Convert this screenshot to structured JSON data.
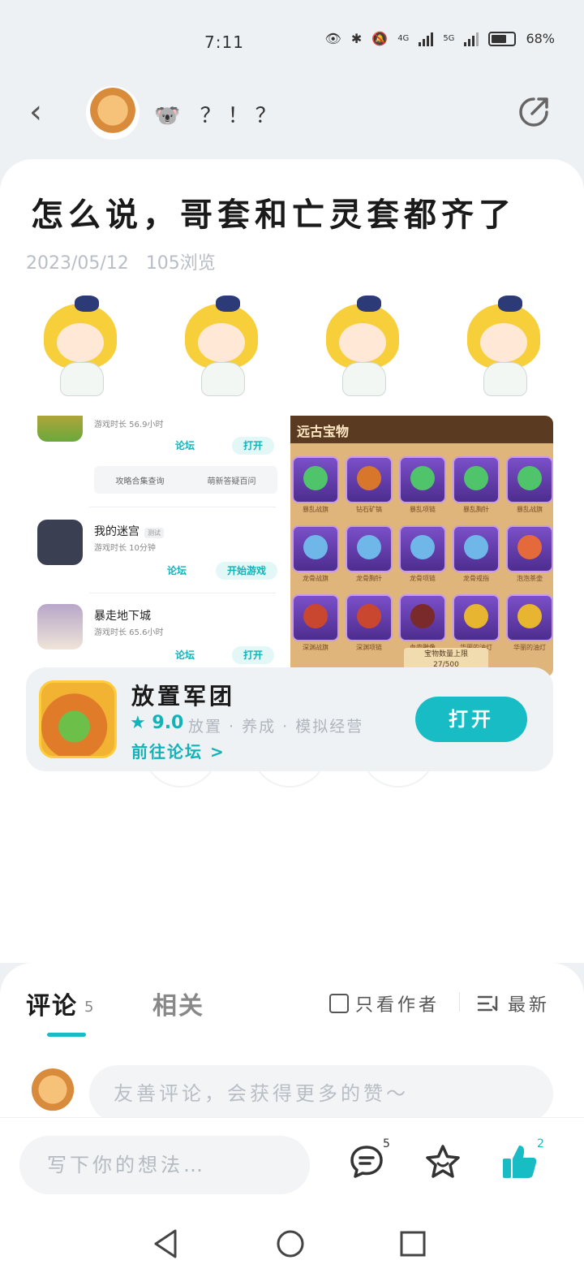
{
  "status_bar": {
    "time": "7:11",
    "network_4g": "4G",
    "network_5g": "5G",
    "battery": "68%"
  },
  "nav": {
    "author_name": "🐨 ？！？"
  },
  "post": {
    "title": "怎么说，哥套和亡灵套都齐了",
    "date": "2023/05/12",
    "views": "105浏览"
  },
  "screenshot": {
    "left": {
      "row1": {
        "play_time": "游戏时长 56.9小时",
        "forum": "论坛",
        "action": "打开"
      },
      "faq": [
        "攻略合集查询",
        "萌新答疑百问"
      ],
      "row2": {
        "name": "我的迷宫",
        "tag": "测试",
        "play_time": "游戏时长 10分钟",
        "forum": "论坛",
        "action": "开始游戏"
      },
      "row3": {
        "name": "暴走地下城",
        "play_time": "游戏时长 65.6小时",
        "forum": "论坛",
        "action": "打开"
      }
    },
    "right": {
      "header": "远古宝物",
      "items": [
        "暴乱战旗",
        "钻石矿镐",
        "暴乱项链",
        "暴乱胸针",
        "暴乱战旗",
        "龙骨战旗",
        "龙骨胸针",
        "龙骨项链",
        "龙骨戒指",
        "泡泡茶壶",
        "深渊战旗",
        "深渊项链",
        "血肉雕像",
        "华丽的油灯",
        "华丽的油灯"
      ],
      "footer_label": "宝物数量上限",
      "footer_count": "27/500"
    }
  },
  "actions": {
    "like_count": "2"
  },
  "game": {
    "name": "放置军团",
    "rating": "9.0",
    "tags": "放置 · 养成 · 模拟经营",
    "forum_link": "前往论坛 >",
    "open_label": "打开"
  },
  "comments": {
    "tab_comments": "评论",
    "comment_count": "5",
    "tab_related": "相关",
    "author_only": "只看作者",
    "sort": "最新",
    "input_placeholder": "友善评论，会获得更多的赞～"
  },
  "bottom": {
    "input_placeholder": "写下你的想法…",
    "comment_badge": "5",
    "like_badge": "2"
  },
  "colors": {
    "accent": "#18bcc4",
    "text": "#1a1a1a",
    "muted": "#b8bec6"
  }
}
